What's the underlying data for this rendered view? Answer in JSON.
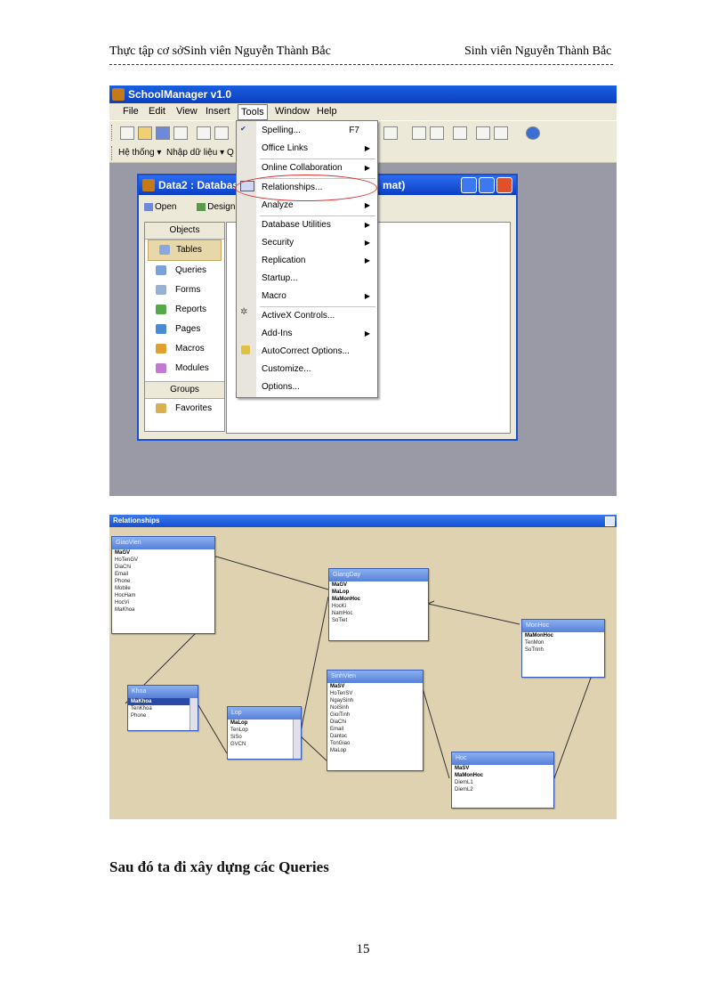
{
  "header": {
    "left": "Thực tập cơ sởSinh viên Nguyễn Thành Bắc",
    "right": "Sinh viên Nguyễn Thành Bắc"
  },
  "app": {
    "title": "SchoolManager v1.0",
    "menu": [
      "File",
      "Edit",
      "View",
      "Insert",
      "Tools",
      "Window",
      "Help"
    ],
    "toolbar2": [
      "Hệ thống ▾",
      "Nhập dữ liệu ▾",
      "Q"
    ]
  },
  "db_window": {
    "title": "Data2 : Database",
    "title_tail": "mat)",
    "open_label": "Open",
    "design_label": "Design",
    "objects_header": "Objects",
    "objects": [
      "Tables",
      "Queries",
      "Forms",
      "Reports",
      "Pages",
      "Macros",
      "Modules"
    ],
    "groups_header": "Groups",
    "favorites": "Favorites"
  },
  "tools_menu": {
    "items": [
      {
        "label": "Spelling...",
        "shortcut": "F7",
        "submenu": false
      },
      {
        "label": "Office Links",
        "shortcut": "",
        "submenu": true
      },
      {
        "label": "Online Collaboration",
        "shortcut": "",
        "submenu": true
      },
      {
        "label": "Relationships...",
        "shortcut": "",
        "submenu": false
      },
      {
        "label": "Analyze",
        "shortcut": "",
        "submenu": true
      },
      {
        "label": "Database Utilities",
        "shortcut": "",
        "submenu": true
      },
      {
        "label": "Security",
        "shortcut": "",
        "submenu": true
      },
      {
        "label": "Replication",
        "shortcut": "",
        "submenu": true
      },
      {
        "label": "Startup...",
        "shortcut": "",
        "submenu": false
      },
      {
        "label": "Macro",
        "shortcut": "",
        "submenu": true
      },
      {
        "label": "ActiveX Controls...",
        "shortcut": "",
        "submenu": false
      },
      {
        "label": "Add-Ins",
        "shortcut": "",
        "submenu": true
      },
      {
        "label": "AutoCorrect Options...",
        "shortcut": "",
        "submenu": false
      },
      {
        "label": "Customize...",
        "shortcut": "",
        "submenu": false
      },
      {
        "label": "Options...",
        "shortcut": "",
        "submenu": false
      }
    ]
  },
  "relationships": {
    "title": "Relationships",
    "tables": [
      {
        "name": "GiaoVien",
        "fields": [
          "MaGV",
          "HoTenGV",
          "DiaChi",
          "Email",
          "Phone",
          "Mobile",
          "HocHam",
          "HocVi",
          "MaKhoa"
        ],
        "keys": [
          "MaGV"
        ]
      },
      {
        "name": "GiangDay",
        "fields": [
          "MaGV",
          "MaLop",
          "MaMonHoc",
          "HocKi",
          "NamHoc",
          "SoTiet"
        ],
        "keys": [
          "MaGV",
          "MaLop",
          "MaMonHoc"
        ]
      },
      {
        "name": "MonHoc",
        "fields": [
          "MaMonHoc",
          "TenMon",
          "SoTrinh"
        ],
        "keys": [
          "MaMonHoc"
        ]
      },
      {
        "name": "Khoa",
        "fields": [
          "MaKhoa",
          "TenKhoa",
          "Phone"
        ],
        "keys": [
          "MaKhoa"
        ]
      },
      {
        "name": "Lop",
        "fields": [
          "MaLop",
          "TenLop",
          "SiSo",
          "GVCN"
        ],
        "keys": [
          "MaLop"
        ]
      },
      {
        "name": "SinhVien",
        "fields": [
          "MaSV",
          "HoTenSV",
          "NgaySinh",
          "NoiSinh",
          "GioiTinh",
          "DiaChi",
          "Email",
          "Dantoc",
          "TonGiao",
          "MaLop"
        ],
        "keys": [
          "MaSV"
        ]
      },
      {
        "name": "Hoc",
        "fields": [
          "MaSV",
          "MaMonHoc",
          "DiemL1",
          "DiemL2"
        ],
        "keys": [
          "MaSV",
          "MaMonHoc"
        ]
      }
    ]
  },
  "caption": "Sau đó ta đi xây dựng các Queries",
  "page_number": "15"
}
